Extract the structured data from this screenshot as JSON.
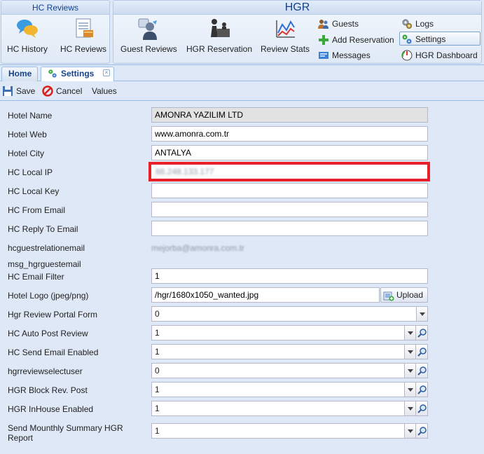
{
  "ribbon": {
    "group1": {
      "title": "HC Reviews",
      "buttons": [
        {
          "label": "HC History",
          "icon": "chat-bubbles-icon"
        },
        {
          "label": "HC Reviews",
          "icon": "document-icon"
        }
      ]
    },
    "group2": {
      "title": "HGR",
      "buttons": [
        {
          "label": "Guest Reviews",
          "icon": "person-reviews-icon"
        },
        {
          "label": "HGR Reservation",
          "icon": "reception-desk-icon"
        },
        {
          "label": "Review Stats",
          "icon": "line-chart-icon"
        }
      ],
      "small": [
        {
          "label": "Guests",
          "icon": "users-icon"
        },
        {
          "label": "Add Reservation",
          "icon": "plus-icon"
        },
        {
          "label": "Messages",
          "icon": "messages-icon"
        },
        {
          "label": "Logs",
          "icon": "gears-icon"
        },
        {
          "label": "Settings",
          "icon": "settings-icon"
        },
        {
          "label": "HGR Dashboard",
          "icon": "dashboard-gauge-icon"
        }
      ]
    }
  },
  "tabs": {
    "home": "Home",
    "settings": "Settings"
  },
  "toolbar": {
    "save": "Save",
    "cancel": "Cancel",
    "values": "Values"
  },
  "form": {
    "hotel_name": {
      "label": "Hotel Name",
      "value": "AMONRA YAZILIM LTD"
    },
    "hotel_web": {
      "label": "Hotel Web",
      "value": "www.amonra.com.tr"
    },
    "hotel_city": {
      "label": "Hotel City",
      "value": "ANTALYA"
    },
    "hc_local_ip": {
      "label": "HC Local IP",
      "value": "88.248.133.177"
    },
    "hc_local_key": {
      "label": "HC Local Key",
      "value": ""
    },
    "hc_from_email": {
      "label": "HC From Email",
      "value": ""
    },
    "hc_reply_email": {
      "label": "HC Reply To Email",
      "value": ""
    },
    "hcguestrelationemail": {
      "label": "hcguestrelationemail",
      "value": "mejorba@amonra.com.tr"
    },
    "msg_hgrguestemail": {
      "label": "msg_hgrguestemail"
    },
    "hc_email_filter": {
      "label": "HC Email Filter",
      "value": "1"
    },
    "hotel_logo": {
      "label": "Hotel Logo (jpeg/png)",
      "value": "/hgr/1680x1050_wanted.jpg",
      "upload": "Upload"
    },
    "hgr_review_portal_form": {
      "label": "Hgr Review Portal Form",
      "value": "0"
    },
    "hc_auto_post_review": {
      "label": "HC Auto Post Review",
      "value": "1"
    },
    "hc_send_email_enabled": {
      "label": "HC Send Email Enabled",
      "value": "1"
    },
    "hgrreviewselectuser": {
      "label": "hgrreviewselectuser",
      "value": "0"
    },
    "hgr_block_rev_post": {
      "label": "HGR Block Rev. Post",
      "value": "1"
    },
    "hgr_inhouse_enabled": {
      "label": "HGR InHouse Enabled",
      "value": "1"
    },
    "send_monthly_summary": {
      "label_line1": "Send Mounthly Summary HGR",
      "label_line2": "Report",
      "value": "1"
    }
  }
}
